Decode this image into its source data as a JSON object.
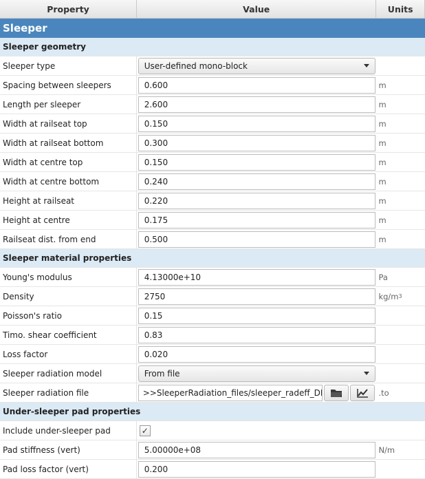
{
  "header": {
    "property": "Property",
    "value": "Value",
    "units": "Units"
  },
  "title": "Sleeper",
  "sections": [
    {
      "label": "Sleeper geometry"
    },
    {
      "label": "Sleeper material properties"
    },
    {
      "label": "Under-sleeper pad properties"
    }
  ],
  "geometry": [
    {
      "label": "Sleeper type",
      "value": "User-defined mono-block",
      "unit": ""
    },
    {
      "label": "Spacing between sleepers",
      "value": "0.600",
      "unit": "m"
    },
    {
      "label": "Length per sleeper",
      "value": "2.600",
      "unit": "m"
    },
    {
      "label": "Width at railseat top",
      "value": "0.150",
      "unit": "m"
    },
    {
      "label": "Width at railseat bottom",
      "value": "0.300",
      "unit": "m"
    },
    {
      "label": "Width at centre top",
      "value": "0.150",
      "unit": "m"
    },
    {
      "label": "Width at centre bottom",
      "value": "0.240",
      "unit": "m"
    },
    {
      "label": "Height at railseat",
      "value": "0.220",
      "unit": "m"
    },
    {
      "label": "Height at centre",
      "value": "0.175",
      "unit": "m"
    },
    {
      "label": "Railseat dist. from end",
      "value": "0.500",
      "unit": "m"
    }
  ],
  "material": [
    {
      "label": "Young's modulus",
      "value": "4.13000e+10",
      "unit": "Pa"
    },
    {
      "label": "Density",
      "value": "2750",
      "unit": "kg/m",
      "unit_sup": "3"
    },
    {
      "label": "Poisson's ratio",
      "value": "0.15",
      "unit": ""
    },
    {
      "label": "Timo. shear coefficient",
      "value": "0.83",
      "unit": ""
    },
    {
      "label": "Loss factor",
      "value": "0.020",
      "unit": ""
    },
    {
      "label": "Sleeper radiation model",
      "value": "From file",
      "unit": ""
    },
    {
      "label": "Sleeper radiation file",
      "value": ">>SleeperRadiation_files/sleeper_radeff_DB.TO",
      "unit": ".to"
    }
  ],
  "pad": [
    {
      "label": "Include under-sleeper pad",
      "value": "✓",
      "unit": ""
    },
    {
      "label": "Pad stiffness (vert)",
      "value": "5.00000e+08",
      "unit": "N/m"
    },
    {
      "label": "Pad loss factor (vert)",
      "value": "0.200",
      "unit": ""
    }
  ],
  "icons": {
    "browse": "folder-icon",
    "plot": "chart-icon",
    "dropdown": "caret-down-icon"
  },
  "colors": {
    "title_bar": "#4a86bd",
    "section_bg": "#dbeaf4"
  }
}
